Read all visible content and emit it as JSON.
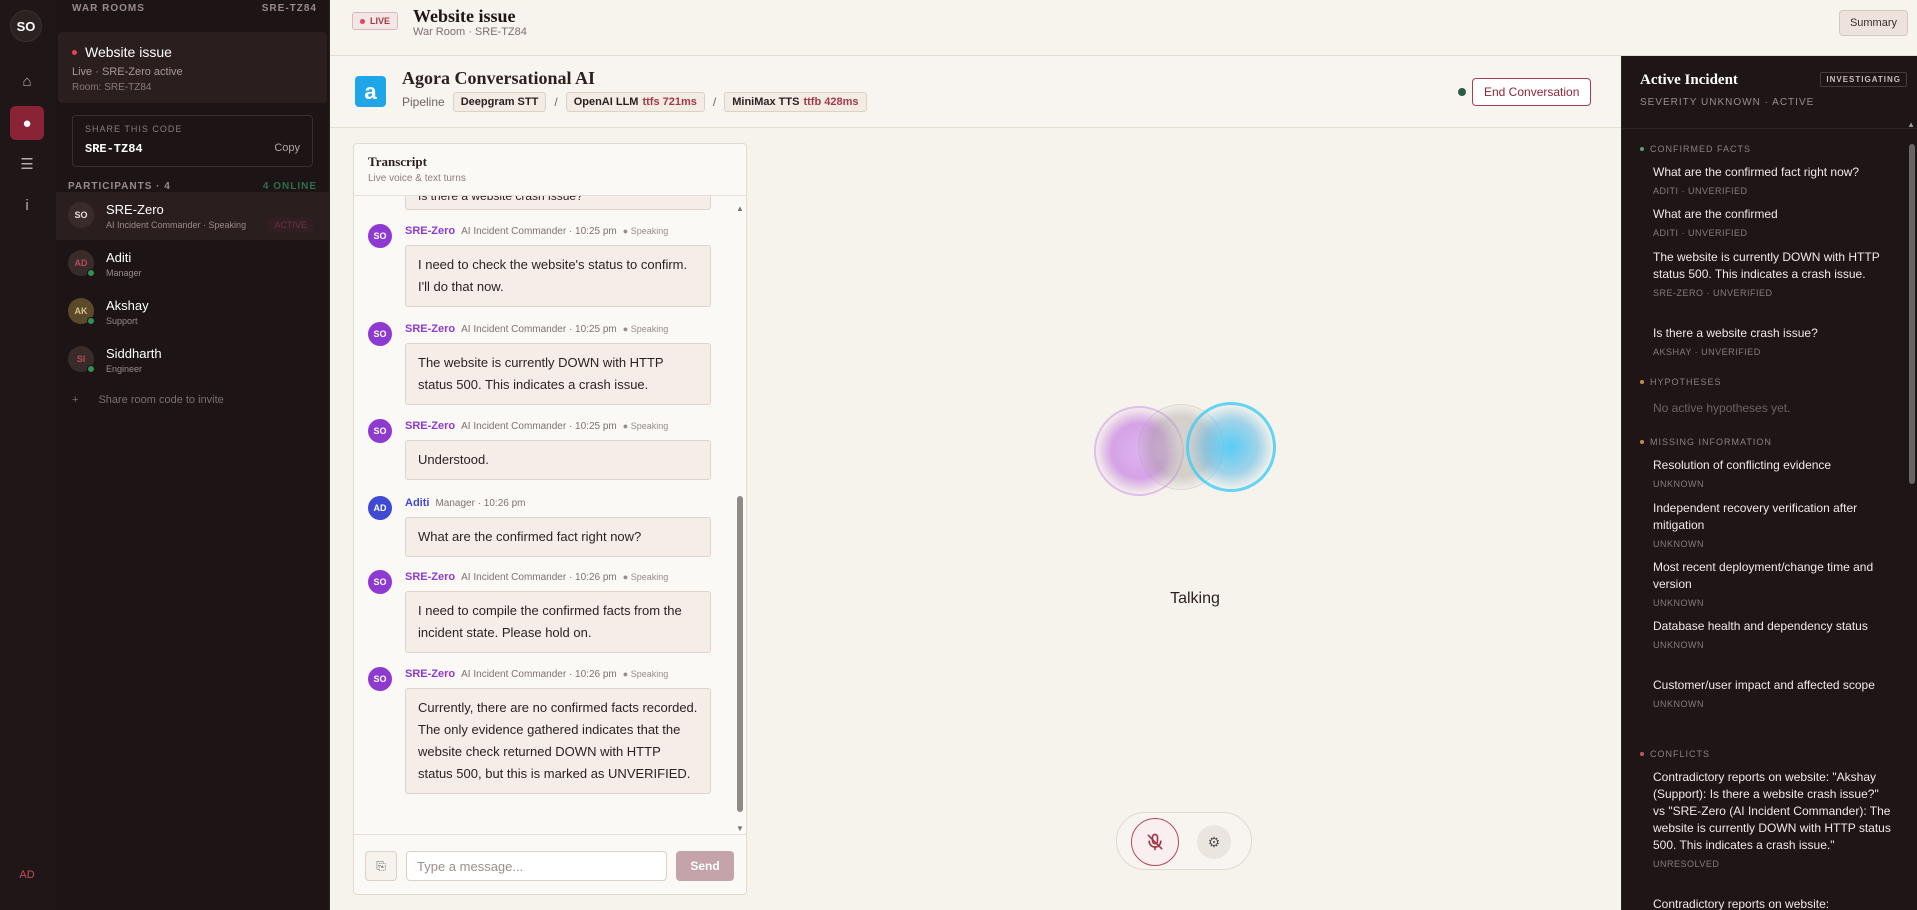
{
  "rail": {
    "avatar": "SO",
    "user_initials": "AD"
  },
  "rooms": {
    "header": "WAR ROOMS",
    "header_code": "SRE-TZ84",
    "active_room": {
      "title": "Website issue",
      "status": "Live · SRE-Zero active",
      "room": "Room: SRE-TZ84"
    },
    "share": {
      "label": "SHARE THIS CODE",
      "code": "SRE-TZ84",
      "copy_label": "Copy"
    },
    "participants_label": "PARTICIPANTS · 4",
    "online_label": "4 ONLINE",
    "participants": [
      {
        "initials": "SO",
        "name": "SRE-Zero",
        "role": "AI Incident Commander · Speaking",
        "badge": "ACTIVE"
      },
      {
        "initials": "AD",
        "name": "Aditi",
        "role": "Manager"
      },
      {
        "initials": "AK",
        "name": "Akshay",
        "role": "Support"
      },
      {
        "initials": "SI",
        "name": "Siddharth",
        "role": "Engineer"
      }
    ],
    "invite_label": "Share room code to invite"
  },
  "topbar": {
    "live": "LIVE",
    "title": "Website issue",
    "subtitle": "War Room · SRE-TZ84",
    "summary_label": "Summary"
  },
  "agora": {
    "logo": "a",
    "title": "Agora Conversational AI",
    "pipeline_label": "Pipeline",
    "stt": "Deepgram STT",
    "llm": "OpenAI LLM",
    "llm_ttfs": "ttfs 721ms",
    "tts": "MiniMax TTS",
    "tts_ttfb": "ttfb 428ms",
    "separator": "/",
    "end_label": "End Conversation"
  },
  "transcript": {
    "title": "Transcript",
    "subtitle": "Live voice & text turns",
    "cut_message": "Is there a website crash issue?",
    "messages": [
      {
        "initials": "SO",
        "who": "SRE-Zero",
        "meta": "AI Incident Commander · 10:25 pm",
        "speaking": "Speaking",
        "text": "I need to check the website's status to confirm. I'll do that now."
      },
      {
        "initials": "SO",
        "who": "SRE-Zero",
        "meta": "AI Incident Commander · 10:25 pm",
        "speaking": "Speaking",
        "text": "The website is currently DOWN with HTTP status 500. This indicates a crash issue."
      },
      {
        "initials": "SO",
        "who": "SRE-Zero",
        "meta": "AI Incident Commander · 10:25 pm",
        "speaking": "Speaking",
        "text": "Understood."
      },
      {
        "initials": "AD",
        "who": "Aditi",
        "meta": "Manager · 10:26 pm",
        "speaking": "",
        "text": "What are the confirmed fact right now?"
      },
      {
        "initials": "SO",
        "who": "SRE-Zero",
        "meta": "AI Incident Commander · 10:26 pm",
        "speaking": "Speaking",
        "text": "I need to compile the confirmed facts from the incident state. Please hold on."
      },
      {
        "initials": "SO",
        "who": "SRE-Zero",
        "meta": "AI Incident Commander · 10:26 pm",
        "speaking": "Speaking",
        "text": "Currently, there are no confirmed facts recorded. The only evidence gathered indicates that the website check returned DOWN with HTTP status 500, but this is marked as UNVERIFIED."
      }
    ],
    "input_placeholder": "Type a message...",
    "send_label": "Send"
  },
  "stage": {
    "status": "Talking"
  },
  "incident": {
    "title": "Active Incident",
    "badge": "INVESTIGATING",
    "subtitle": "SEVERITY UNKNOWN · ACTIVE",
    "confirmed_label": "CONFIRMED FACTS",
    "confirmed": [
      {
        "text": "What are the confirmed fact right now?",
        "meta": "ADITI · UNVERIFIED"
      },
      {
        "text": "What are the confirmed",
        "meta": "ADITI · UNVERIFIED"
      },
      {
        "text": "The website is currently DOWN with HTTP status 500. This indicates a crash issue.",
        "meta": "SRE-ZERO · UNVERIFIED"
      },
      {
        "text": "Is there a website crash issue?",
        "meta": "AKSHAY · UNVERIFIED"
      }
    ],
    "hypotheses_label": "HYPOTHESES",
    "hypotheses_empty": "No active hypotheses yet.",
    "missing_label": "MISSING INFORMATION",
    "missing": [
      {
        "text": "Resolution of conflicting evidence",
        "meta": "UNKNOWN"
      },
      {
        "text": "Independent recovery verification after mitigation",
        "meta": "UNKNOWN"
      },
      {
        "text": "Most recent deployment/change time and version",
        "meta": "UNKNOWN"
      },
      {
        "text": "Database health and dependency status",
        "meta": "UNKNOWN"
      },
      {
        "text": "Customer/user impact and affected scope",
        "meta": "UNKNOWN"
      }
    ],
    "conflicts_label": "CONFLICTS",
    "conflicts": [
      {
        "text": "Contradictory reports on website: \"Akshay (Support): Is there a website crash issue?\" vs \"SRE-Zero (AI Incident Commander): The website is currently DOWN with HTTP status 500. This indicates a crash issue.\"",
        "meta": "UNRESOLVED"
      },
      {
        "text": "Contradictory reports on website:",
        "meta": ""
      }
    ]
  }
}
